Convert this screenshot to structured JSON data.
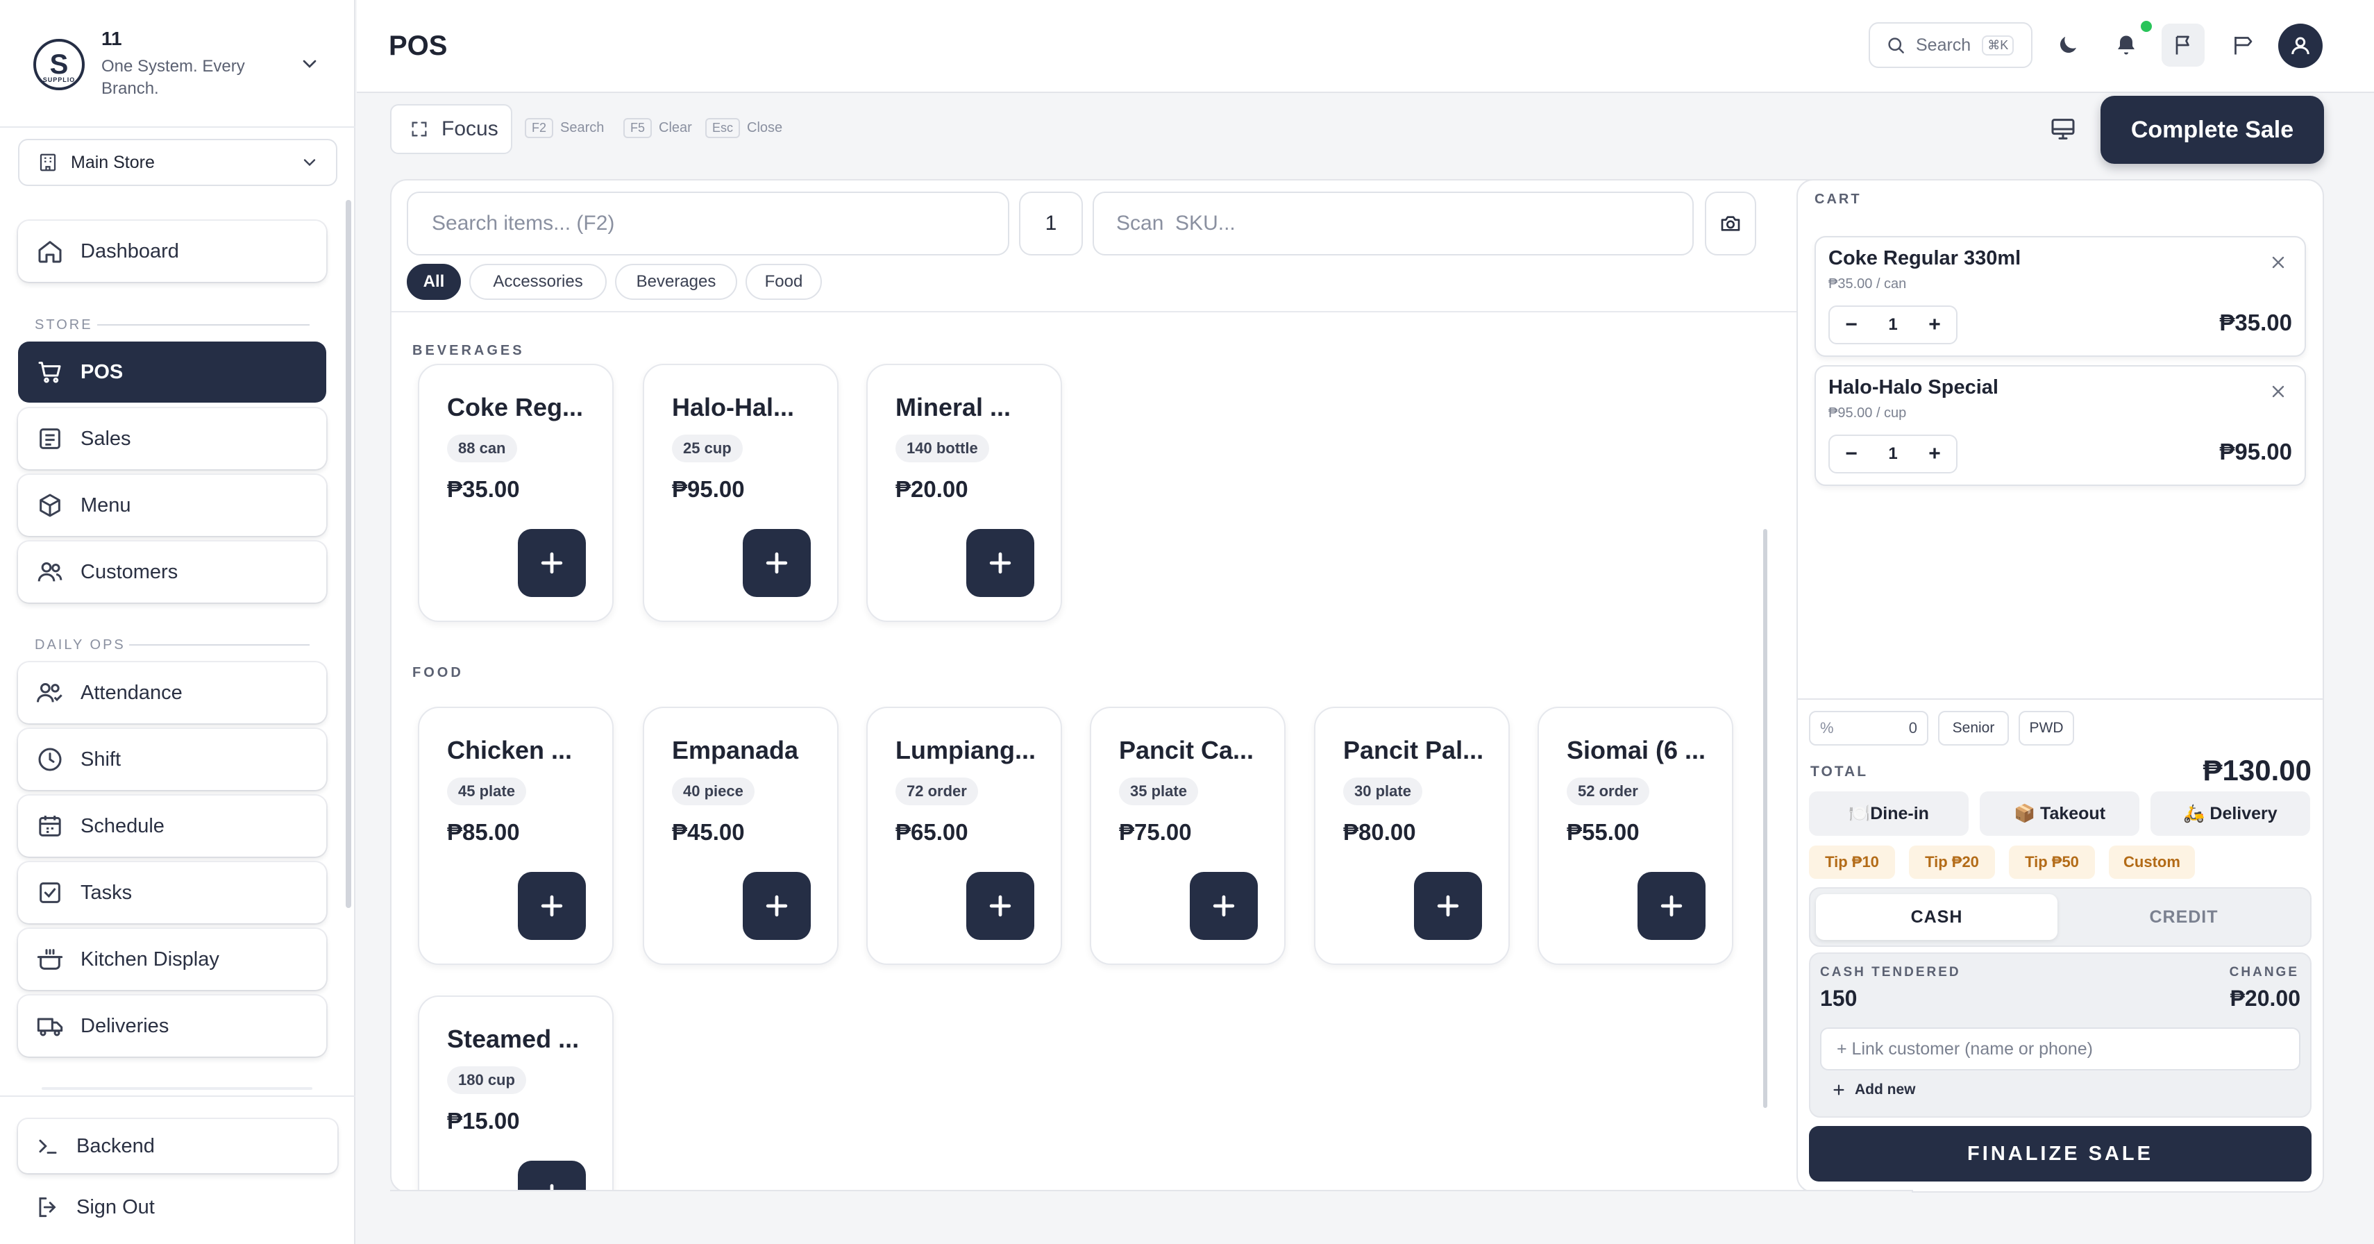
{
  "brand": {
    "name": "11",
    "tagline": "One System. Every Branch.",
    "logo_letter": "S",
    "logo_sub": "SUPPLIO"
  },
  "store_select": {
    "value": "Main Store"
  },
  "nav": {
    "dashboard": "Dashboard",
    "section_store": "STORE",
    "pos": "POS",
    "sales": "Sales",
    "menu": "Menu",
    "customers": "Customers",
    "section_daily": "DAILY OPS",
    "attendance": "Attendance",
    "shift": "Shift",
    "schedule": "Schedule",
    "tasks": "Tasks",
    "kitchen": "Kitchen Display",
    "deliveries": "Deliveries",
    "backend": "Backend",
    "signout": "Sign Out"
  },
  "header": {
    "title": "POS",
    "search_label": "Search",
    "search_kbd": "⌘K"
  },
  "toolbar": {
    "focus_label": "Focus",
    "hints": [
      {
        "key": "F2",
        "label": "Search"
      },
      {
        "key": "F5",
        "label": "Clear"
      },
      {
        "key": "Esc",
        "label": "Close"
      }
    ],
    "complete_label": "Complete Sale"
  },
  "item_search": {
    "placeholder": "Search items... (F2)",
    "quantity": "1",
    "sku_placeholder": "Scan  SKU..."
  },
  "filters": [
    "All",
    "Accessories",
    "Beverages",
    "Food"
  ],
  "categories": {
    "beverages": {
      "title": "BEVERAGES",
      "items": [
        {
          "name": "Coke Reg...",
          "stock": "88 can",
          "price": "₱35.00"
        },
        {
          "name": "Halo-Hal...",
          "stock": "25 cup",
          "price": "₱95.00"
        },
        {
          "name": "Mineral ...",
          "stock": "140 bottle",
          "price": "₱20.00"
        }
      ]
    },
    "food": {
      "title": "FOOD",
      "items": [
        {
          "name": "Chicken ...",
          "stock": "45 plate",
          "price": "₱85.00"
        },
        {
          "name": "Empanada",
          "stock": "40 piece",
          "price": "₱45.00"
        },
        {
          "name": "Lumpiang...",
          "stock": "72 order",
          "price": "₱65.00"
        },
        {
          "name": "Pancit Ca...",
          "stock": "35 plate",
          "price": "₱75.00"
        },
        {
          "name": "Pancit Pal...",
          "stock": "30 plate",
          "price": "₱80.00"
        },
        {
          "name": "Siomai (6 ...",
          "stock": "52 order",
          "price": "₱55.00"
        },
        {
          "name": "Steamed ...",
          "stock": "180 cup",
          "price": "₱15.00"
        }
      ]
    }
  },
  "cart": {
    "title": "CART",
    "items": [
      {
        "name": "Coke Regular 330ml",
        "unit": "₱35.00 / can",
        "qty": "1",
        "total": "₱35.00"
      },
      {
        "name": "Halo-Halo Special",
        "unit": "₱95.00 / cup",
        "qty": "1",
        "total": "₱95.00"
      }
    ],
    "discount_symbol": "%",
    "discount_value": "0",
    "senior_label": "Senior",
    "pwd_label": "PWD",
    "total_label": "TOTAL",
    "total_value": "₱130.00",
    "order_types": [
      "🍽️Dine-in",
      "📦 Takeout",
      "🛵 Delivery"
    ],
    "tips": [
      "Tip ₱10",
      "Tip ₱20",
      "Tip ₱50",
      "Custom"
    ],
    "payment_tabs": [
      "CASH",
      "CREDIT"
    ],
    "cash_tendered_label": "CASH TENDERED",
    "cash_tendered_value": "150",
    "change_label": "CHANGE",
    "change_value": "₱20.00",
    "link_customer_placeholder": "+ Link customer (name or phone)",
    "add_new_label": "Add new",
    "finalize_label": "FINALIZE SALE"
  },
  "colors": {
    "primary": "#252e45",
    "tip_bg": "#fdf3e3",
    "tip_text": "#b36b17",
    "online_dot": "#29c45a"
  }
}
